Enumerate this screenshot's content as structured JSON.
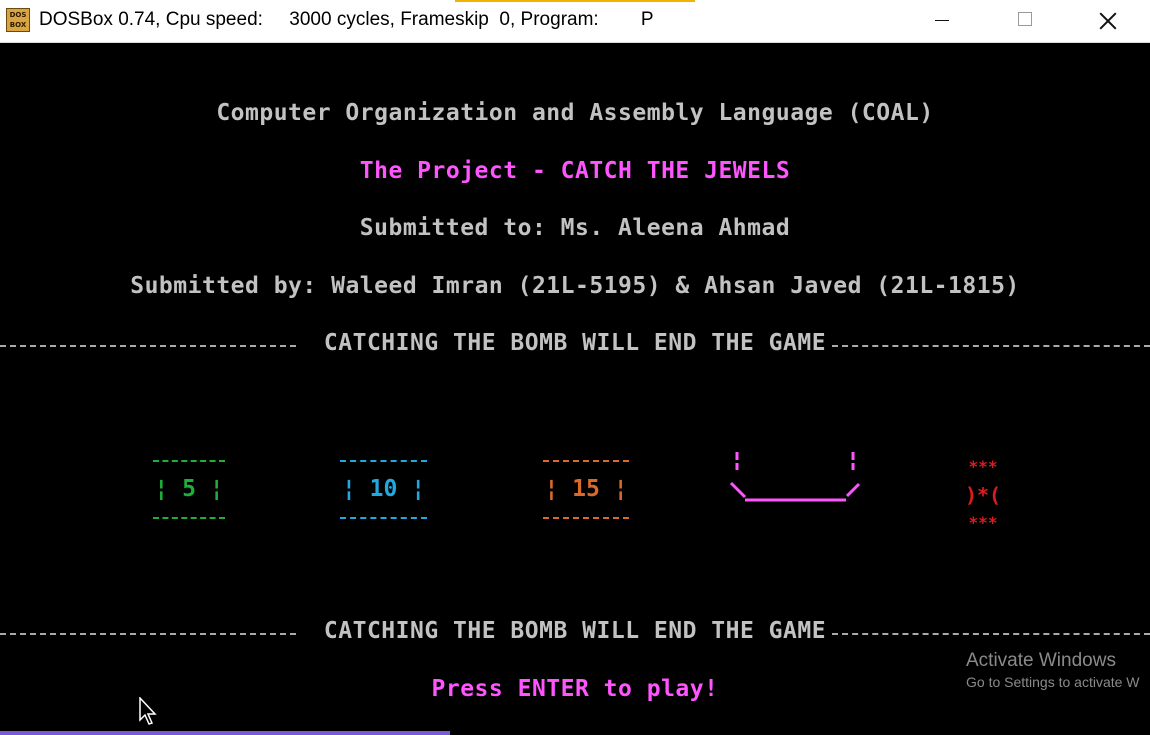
{
  "window": {
    "icon_label": "DOS BOX",
    "title": "DOSBox 0.74, Cpu speed:     3000 cycles, Frameskip  0, Program:        P"
  },
  "screen": {
    "course": "Computer Organization and Assembly Language (COAL)",
    "project": "The Project - CATCH THE JEWELS",
    "submitted_to": "Submitted to: Ms. Aleena Ahmad",
    "submitted_by": "Submitted by: Waleed Imran (21L-5195) & Ahsan Javed (21L-1815)",
    "warning": "CATCHING THE BOMB WILL END THE GAME",
    "jewels": [
      {
        "label": "¦ 5 ¦",
        "points": 5,
        "color": "#1fae3a"
      },
      {
        "label": "¦ 10 ¦",
        "points": 10,
        "color": "#22a8e0"
      },
      {
        "label": "¦ 15 ¦",
        "points": 15,
        "color": "#d96a2a"
      }
    ],
    "bomb": {
      "top": "***",
      "middle": ")*(",
      "bottom": "***",
      "color": "#dd1c1c"
    },
    "basket_color": "#ff55ff",
    "prompt": "Press ENTER to play!"
  },
  "watermark": {
    "line1": "Activate Windows",
    "line2": "Go to Settings to activate W"
  }
}
